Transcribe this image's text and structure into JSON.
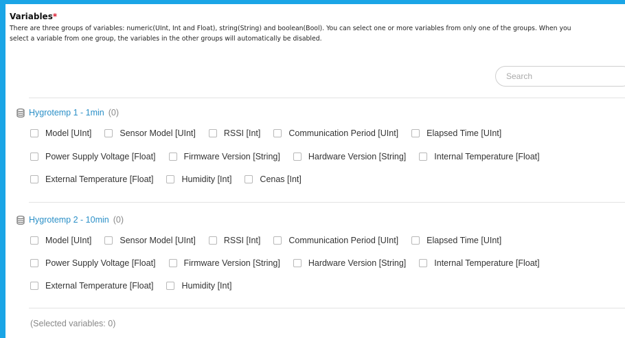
{
  "section": {
    "title": "Variables",
    "required_mark": "*",
    "description": "There are three groups of variables: numeric(UInt, Int and Float), string(String) and boolean(Bool). You can select one or more variables from only one of the groups. When you select a variable from one group, the variables in the other groups will automatically be disabled."
  },
  "search": {
    "placeholder": "Search"
  },
  "groups": [
    {
      "name": "Hygrotemp 1 - 1min",
      "count": "(0)",
      "icon": "database-icon",
      "rows": [
        [
          "Model [UInt]",
          "Sensor Model [UInt]",
          "RSSI [Int]",
          "Communication Period [UInt]",
          "Elapsed Time [UInt]"
        ],
        [
          "Power Supply Voltage [Float]",
          "Firmware Version [String]",
          "Hardware Version [String]",
          "Internal Temperature [Float]"
        ],
        [
          "External Temperature [Float]",
          "Humidity [Int]",
          "Cenas [Int]"
        ]
      ]
    },
    {
      "name": "Hygrotemp 2 - 10min",
      "count": "(0)",
      "icon": "database-icon",
      "rows": [
        [
          "Model [UInt]",
          "Sensor Model [UInt]",
          "RSSI [Int]",
          "Communication Period [UInt]",
          "Elapsed Time [UInt]"
        ],
        [
          "Power Supply Voltage [Float]",
          "Firmware Version [String]",
          "Hardware Version [String]",
          "Internal Temperature [Float]"
        ],
        [
          "External Temperature [Float]",
          "Humidity [Int]"
        ]
      ]
    }
  ],
  "footer": {
    "selected_text": "(Selected variables: 0)"
  },
  "colors": {
    "accent_border": "#1aa5e6",
    "group_link": "#2a8fc7",
    "required": "#d9182d"
  }
}
